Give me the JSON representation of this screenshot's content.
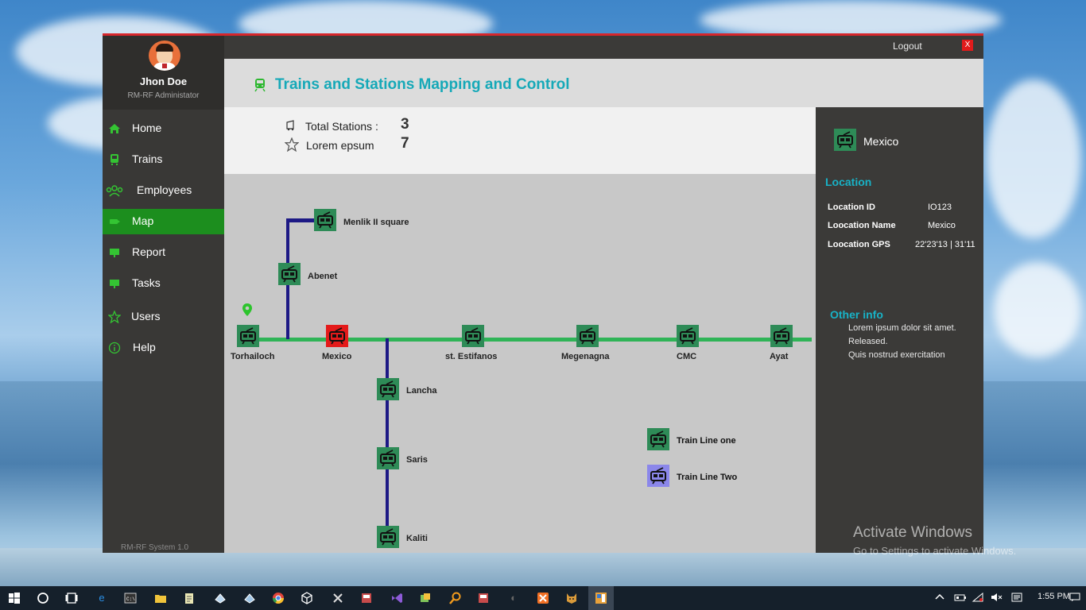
{
  "user": {
    "name": "Jhon Doe",
    "role": "RM-RF Administator"
  },
  "nav": [
    {
      "label": "Home",
      "icon": "home-icon",
      "active": false
    },
    {
      "label": "Trains",
      "icon": "train-icon",
      "active": false
    },
    {
      "label": "Employees",
      "icon": "people-icon",
      "active": false
    },
    {
      "label": "Map",
      "icon": "map-icon",
      "active": true
    },
    {
      "label": "Report",
      "icon": "report-icon",
      "active": false
    },
    {
      "label": "Tasks",
      "icon": "tasks-icon",
      "active": false
    },
    {
      "label": "Users",
      "icon": "star-icon",
      "active": false
    },
    {
      "label": "Help",
      "icon": "info-icon",
      "active": false
    }
  ],
  "system_label": "RM-RF System  1.0",
  "titlebar": {
    "logout": "Logout",
    "close": "X"
  },
  "header": {
    "title": "Trains and Stations Mapping and Control"
  },
  "stats": {
    "total_label": "Total Stations :",
    "total_value": "3",
    "lorem_label": "Lorem epsum",
    "lorem_value": "7"
  },
  "map": {
    "stations": {
      "menlik": "Menlik II square",
      "abenet": "Abenet",
      "torhailoch": "Torhailoch",
      "mexico": "Mexico",
      "estifanos": "st. Estifanos",
      "megenagna": "Megenagna",
      "cmc": "CMC",
      "ayat": "Ayat",
      "lancha": "Lancha",
      "saris": "Saris",
      "kaliti": "Kaliti"
    },
    "legend": {
      "line_one": "Train Line one",
      "line_two": "Train Line Two"
    }
  },
  "info": {
    "selected": "Mexico",
    "location_heading": "Location",
    "location_id_label": "Location ID",
    "location_id_value": "IO123",
    "location_name_label": "Loocation Name",
    "location_name_value": "Mexico",
    "location_gps_label": "Loocation GPS",
    "location_gps_value": "22'23'13 | 31'11",
    "other_heading": "Other info",
    "other_lines": [
      "Lorem ipsum dolor sit amet.",
      "Released.",
      "Quis nostrud exercitation"
    ]
  },
  "watermark": {
    "line1": "Activate Windows",
    "line2": "Go to Settings to activate Windows."
  },
  "taskbar": {
    "time": "1:55 PM"
  },
  "colors": {
    "accent_green": "#1c8e1e",
    "title_cyan": "#16a9b8",
    "selected_red": "#e41a1a",
    "line_one": "#2fb457",
    "line_two": "#1d1985"
  }
}
